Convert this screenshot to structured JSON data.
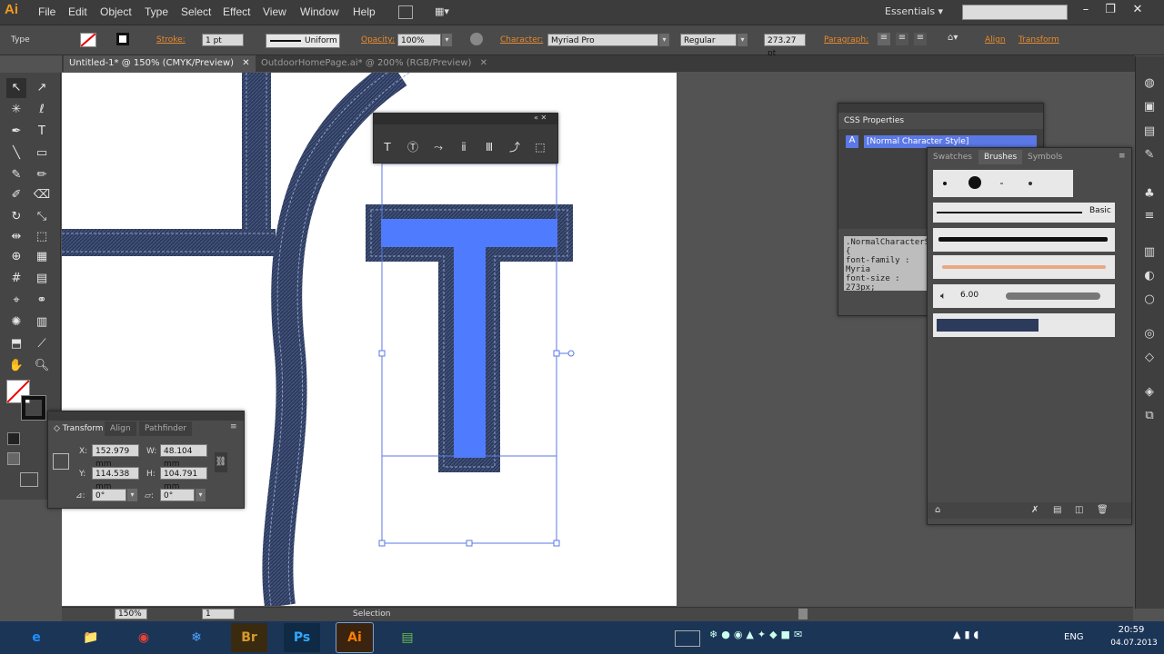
{
  "app": {
    "logo": "Ai",
    "workspace": "Essentials ▾"
  },
  "menu": [
    "File",
    "Edit",
    "Object",
    "Type",
    "Select",
    "Effect",
    "View",
    "Window",
    "Help"
  ],
  "window_controls": [
    "–",
    "❐",
    "✕"
  ],
  "control": {
    "type_label": "Type",
    "stroke_label": "Stroke:",
    "stroke_weight": "1 pt",
    "stroke_profile": "Uniform",
    "opacity_label": "Opacity:",
    "opacity_value": "100%",
    "character_label": "Character:",
    "font_family": "Myriad Pro",
    "font_style": "Regular",
    "font_size": "273.27 pt",
    "paragraph_label": "Paragraph:",
    "align_label": "Align",
    "transform_label": "Transform"
  },
  "tabs": [
    {
      "label": "Untitled-1* @ 150% (CMYK/Preview)",
      "close": "✕"
    },
    {
      "label": "OutdoorHomePage.ai* @ 200% (RGB/Preview)",
      "close": "✕"
    }
  ],
  "canvas": {
    "letter": "T",
    "colors": {
      "fill": "#4f7cff",
      "denim": "#2c3a5c",
      "stitch": "#8fa0c8",
      "selection": "#5a78e6"
    }
  },
  "transform_panel": {
    "tabs": [
      "◇ Transform",
      "Align",
      "Pathfinder"
    ],
    "x_label": "X:",
    "x_value": "152.979 mm",
    "y_label": "Y:",
    "y_value": "114.538 mm",
    "w_label": "W:",
    "w_value": "48.104 mm",
    "h_label": "H:",
    "h_value": "104.791 mm",
    "rotate_label": "⊿:",
    "rotate_value": "0°",
    "shear_label": "▱:",
    "shear_value": "0°"
  },
  "css_panel": {
    "title": "CSS Properties",
    "item": "[Normal Character Style]",
    "code_line1": ".NormalCharacterS",
    "code_line2": "{",
    "code_line3": "font-family : Myria",
    "code_line4": "font-size : 273px;"
  },
  "brushes_panel": {
    "tabs": [
      "Swatches",
      "Brushes",
      "Symbols"
    ],
    "basic_label": "Basic",
    "size_value": "6.00"
  },
  "status": {
    "zoom": "150%",
    "page": "1",
    "mode": "Selection"
  },
  "taskbar": {
    "apps": [
      {
        "label": "e",
        "color": "#1e90ff"
      },
      {
        "label": "📁",
        "color": "#e8c25a"
      },
      {
        "label": "◉",
        "color": "#e94235"
      },
      {
        "label": "❄",
        "color": "#4fa3ff"
      },
      {
        "label": "Br",
        "color": "#d99a2b"
      },
      {
        "label": "Ps",
        "color": "#31a8ff"
      },
      {
        "label": "Ai",
        "color": "#ff7c00"
      },
      {
        "label": "▤",
        "color": "#6cbf4f"
      }
    ],
    "lang": "ENG",
    "time": "20:59",
    "date": "04.07.2013"
  }
}
